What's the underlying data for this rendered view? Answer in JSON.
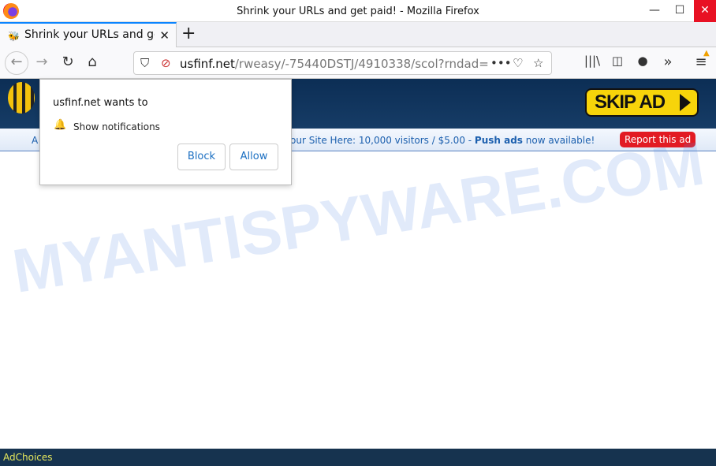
{
  "window": {
    "title": "Shrink your URLs and get paid! - Mozilla Firefox"
  },
  "tab": {
    "label": "Shrink your URLs and get paid!"
  },
  "urlbar": {
    "domain": "usfinf.net",
    "path": "/rweasy/-75440DSTJ/4910338/scol?rndad="
  },
  "header": {
    "skip_label": "SKIP AD"
  },
  "strip": {
    "left": "A",
    "text_pre": "our Site Here: 10,000 visitors / $5.00 - ",
    "text_bold": "Push ads",
    "text_post": " now available!",
    "report_label": "Report this ad"
  },
  "footer": {
    "adchoices": "AdChoices"
  },
  "popup": {
    "title": "usfinf.net wants to",
    "permission": "Show notifications",
    "block_label": "Block",
    "allow_label": "Allow"
  },
  "watermark": "MYANTISPYWARE.COM",
  "colors": {
    "header": "#0c2e55",
    "report": "#e21b23",
    "skip": "#f7d40a",
    "close": "#e81123"
  }
}
